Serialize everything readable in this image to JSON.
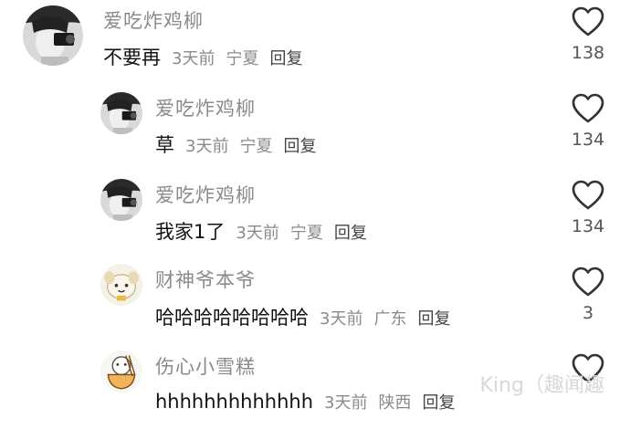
{
  "comments": [
    {
      "username": "爱吃炸鸡柳",
      "content": "不要再",
      "time": "3天前",
      "location": "宁夏",
      "reply_label": "回复",
      "likes": "138",
      "avatar_icon": "person-holding-camera-avatar"
    },
    {
      "username": "爱吃炸鸡柳",
      "content": "草",
      "time": "3天前",
      "location": "宁夏",
      "reply_label": "回复",
      "likes": "134",
      "avatar_icon": "person-holding-camera-avatar"
    },
    {
      "username": "爱吃炸鸡柳",
      "content": "我家1了",
      "time": "3天前",
      "location": "宁夏",
      "reply_label": "回复",
      "likes": "134",
      "avatar_icon": "person-holding-camera-avatar"
    },
    {
      "username": "财神爷本爷",
      "content": "哈哈哈哈哈哈哈哈",
      "time": "3天前",
      "location": "广东",
      "reply_label": "回复",
      "likes": "3",
      "avatar_icon": "cartoon-dog-avatar"
    },
    {
      "username": "伤心小雪糕",
      "content": "hhhhhhhhhhhhh",
      "time": "3天前",
      "location": "陕西",
      "reply_label": "回复",
      "likes": "",
      "avatar_icon": "cartoon-noodle-bowl-avatar"
    }
  ],
  "watermark": "King（趣闻趣",
  "colors": {
    "username": "#8a8a8a",
    "content": "#111111",
    "meta": "#8a8a8a",
    "heart_outline": "#333333"
  }
}
